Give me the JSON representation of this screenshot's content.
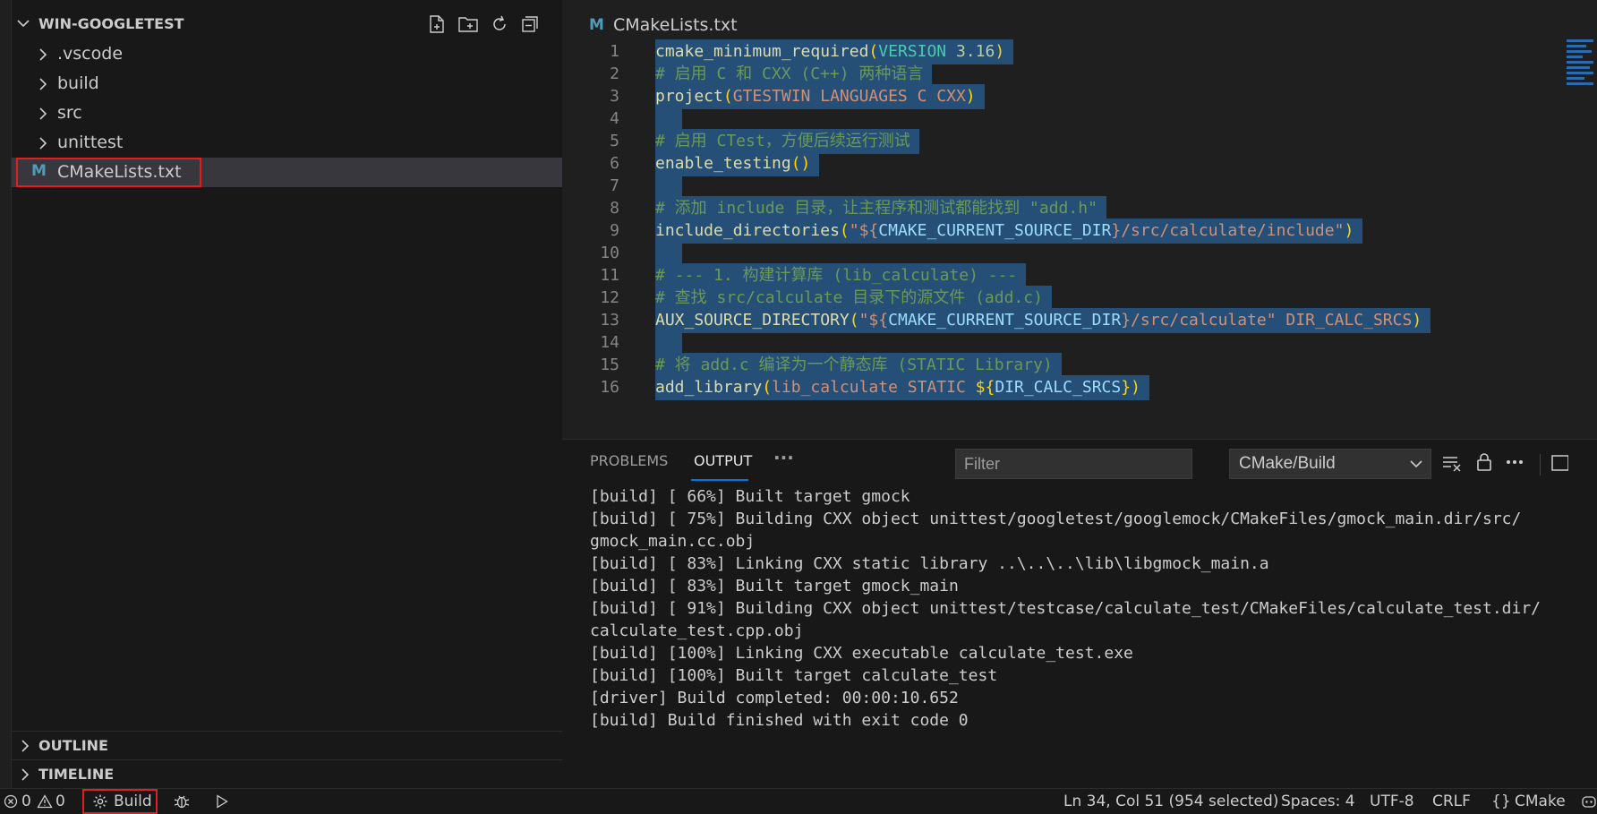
{
  "explorer": {
    "title": "WIN-GOOGLETEST",
    "folders": [
      ".vscode",
      "build",
      "src",
      "unittest"
    ],
    "active_file": "CMakeLists.txt",
    "active_file_icon": "M",
    "sections": [
      "OUTLINE",
      "TIMELINE"
    ]
  },
  "editor": {
    "tab_name": "CMakeLists.txt",
    "tab_icon": "M",
    "line_numbers": [
      "1",
      "2",
      "3",
      "4",
      "5",
      "6",
      "7",
      "8",
      "9",
      "10",
      "11",
      "12",
      "13",
      "14",
      "15",
      "16"
    ],
    "lines": {
      "l1": {
        "cmd": "cmake_minimum_required",
        "p1": "(",
        "kw": "VERSION",
        "sp": " ",
        "num": "3.16",
        "p2": ")"
      },
      "l2": {
        "com": "# 启用 C 和 CXX (C++) 两种语言"
      },
      "l3": {
        "cmd": "project",
        "p1": "(",
        "a1": "GTESTWIN LANGUAGES C CXX",
        "p2": ")"
      },
      "l5": {
        "com": "# 启用 CTest，方便后续运行测试"
      },
      "l6": {
        "cmd": "enable_testing",
        "p1": "()"
      },
      "l8": {
        "com": "# 添加 include 目录，让主程序和测试都能找到 \"add.h\""
      },
      "l9": {
        "cmd": "include_directories",
        "p1": "(",
        "s1": "\"${",
        "v1": "CMAKE_CURRENT_SOURCE_DIR",
        "s2": "}/src/calculate/include\"",
        "p2": ")"
      },
      "l11": {
        "com": "# --- 1. 构建计算库 (lib_calculate) ---"
      },
      "l12": {
        "com": "# 查找 src/calculate 目录下的源文件 (add.c)"
      },
      "l13": {
        "cmd": "AUX_SOURCE_DIRECTORY",
        "p1": "(",
        "s1": "\"${",
        "v1": "CMAKE_CURRENT_SOURCE_DIR",
        "s2": "}/src/calculate\"",
        "a1": " DIR_CALC_SRCS",
        "p2": ")"
      },
      "l15": {
        "com": "# 将 add.c 编译为一个静态库 (STATIC Library)"
      },
      "l16": {
        "cmd": "add_library",
        "p1": "(",
        "a1": "lib_calculate STATIC ",
        "s1": "${",
        "v1": "DIR_CALC_SRCS",
        "s2": "}",
        "p2": ")"
      }
    }
  },
  "panel": {
    "tabs": [
      "PROBLEMS",
      "OUTPUT"
    ],
    "active_tab": "OUTPUT",
    "more": "···",
    "filter_placeholder": "Filter",
    "channel": "CMake/Build",
    "output": [
      "[build] [ 66%] Built target gmock",
      "[build] [ 75%] Building CXX object unittest/googletest/googlemock/CMakeFiles/gmock_main.dir/src/",
      "gmock_main.cc.obj",
      "[build] [ 83%] Linking CXX static library ..\\..\\..\\lib\\libgmock_main.a",
      "[build] [ 83%] Built target gmock_main",
      "[build] [ 91%] Building CXX object unittest/testcase/calculate_test/CMakeFiles/calculate_test.dir/",
      "calculate_test.cpp.obj",
      "[build] [100%] Linking CXX executable calculate_test.exe",
      "[build] [100%] Built target calculate_test",
      "[driver] Build completed: 00:00:10.652",
      "[build] Build finished with exit code 0"
    ]
  },
  "statusbar": {
    "errors": "0",
    "warnings": "0",
    "build": "Build",
    "position": "Ln 34, Col 51 (954 selected)",
    "spaces": "Spaces: 4",
    "encoding": "UTF-8",
    "eol": "CRLF",
    "language_icon": "{}",
    "language": "CMake"
  },
  "colors": {
    "accent": "#0078d4",
    "highlight_box": "#e02020",
    "selection": "#264f78"
  }
}
